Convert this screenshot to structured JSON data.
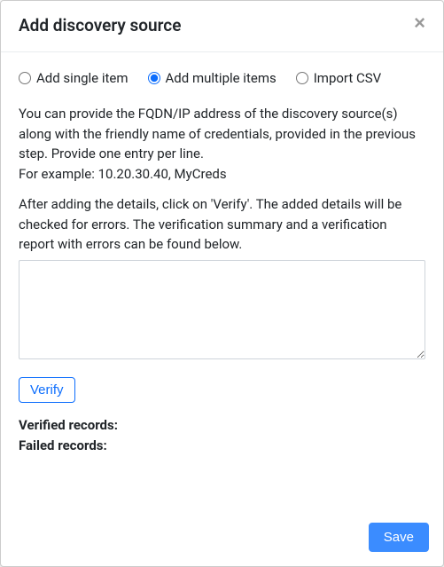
{
  "header": {
    "title": "Add discovery source",
    "close_label": "×"
  },
  "radios": {
    "single": "Add single item",
    "multiple": "Add multiple items",
    "import_csv": "Import CSV",
    "selected": "multiple"
  },
  "instructions": {
    "para1": "You can provide the FQDN/IP address of the discovery source(s) along with the friendly name of credentials, provided in the previous step. Provide one entry per line.",
    "example": "For example: 10.20.30.40, MyCreds",
    "para2": "After adding the details, click on 'Verify'. The added details will be checked for errors. The verification summary and a verification report with errors can be found below."
  },
  "textarea": {
    "value": "",
    "placeholder": ""
  },
  "buttons": {
    "verify": "Verify",
    "save": "Save"
  },
  "summary": {
    "verified_label": "Verified records:",
    "failed_label": "Failed records:"
  }
}
